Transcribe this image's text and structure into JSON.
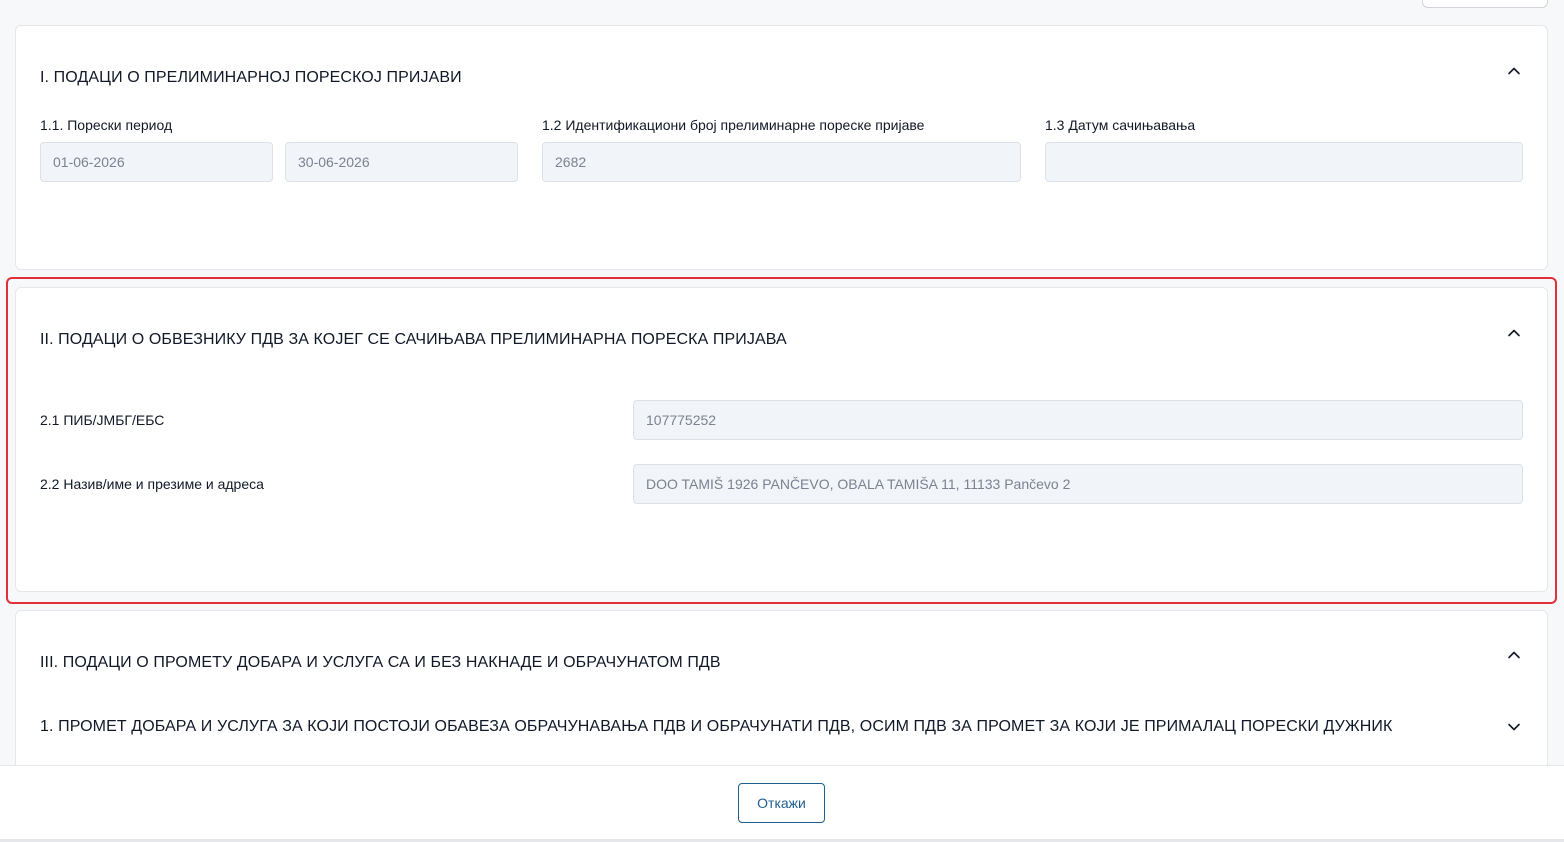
{
  "section1": {
    "title": "I. ПОДАЦИ О ПРЕЛИМИНАРНОЈ ПОРЕСКОЈ ПРИЈАВИ",
    "period_label": "1.1. Порески период",
    "period_from": "01-06-2026",
    "period_to": "30-06-2026",
    "id_label": "1.2 Идентификациони број прелиминарне пореске пријаве",
    "id_value": "2682",
    "date_label": "1.3 Датум сачињавања",
    "date_value": ""
  },
  "section2": {
    "title": "II. ПОДАЦИ О ОБВЕЗНИКУ ПДВ ЗА КОЈЕГ СЕ САЧИЊАВА ПРЕЛИМИНАРНА ПОРЕСКА ПРИЈАВА",
    "pib_label": "2.1 ПИБ/ЈМБГ/ЕБС",
    "pib_value": "107775252",
    "name_label": "2.2 Назив/име и презиме и адреса",
    "name_value": "DOO TAMIŠ 1926 PANČEVO, OBALA TAMIŠA 11, 11133 Pančevo 2"
  },
  "section3": {
    "title": "III. ПОДАЦИ О ПРОМЕТУ ДОБАРА И УСЛУГА СА И БЕЗ НАКНАДЕ И ОБРАЧУНАТОМ ПДВ",
    "subsection1_title": "1. ПРОМЕТ ДОБАРА И УСЛУГА ЗА КОЈИ ПОСТОЈИ ОБАВЕЗА ОБРАЧУНАВАЊА ПДВ И ОБРАЧУНАТИ ПДВ, ОСИМ ПДВ ЗА ПРОМЕТ ЗА КОЈИ ЈЕ ПРИМАЛАЦ ПОРЕСКИ ДУЖНИК"
  },
  "footer": {
    "cancel_label": "Откажи"
  },
  "colors": {
    "highlight": "#e0303a",
    "accent": "#1f5f8f",
    "input_bg": "#f1f4f8"
  }
}
